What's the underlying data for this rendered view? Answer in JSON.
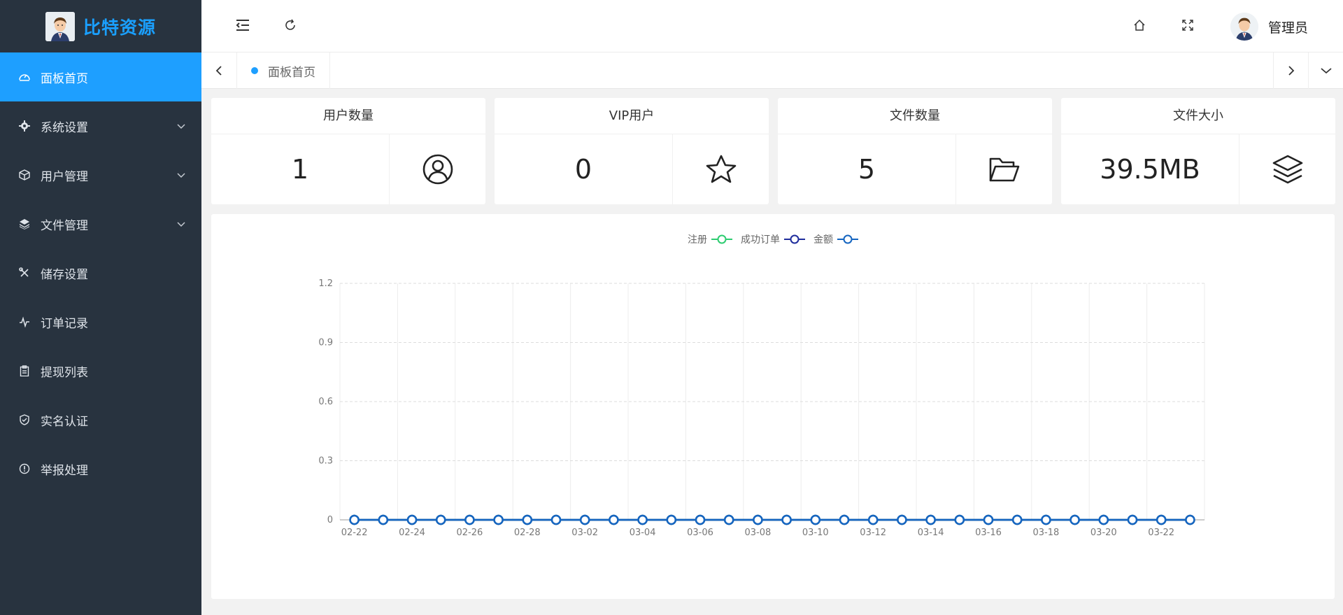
{
  "app": {
    "brand": "比特资源"
  },
  "sidebar": {
    "items": [
      {
        "label": "面板首页",
        "icon": "dashboard-icon",
        "active": true,
        "expandable": false
      },
      {
        "label": "系统设置",
        "icon": "gear-icon",
        "active": false,
        "expandable": true
      },
      {
        "label": "用户管理",
        "icon": "cube-icon",
        "active": false,
        "expandable": true
      },
      {
        "label": "文件管理",
        "icon": "layers-icon",
        "active": false,
        "expandable": true
      },
      {
        "label": "储存设置",
        "icon": "tools-icon",
        "active": false,
        "expandable": false
      },
      {
        "label": "订单记录",
        "icon": "pulse-icon",
        "active": false,
        "expandable": false
      },
      {
        "label": "提现列表",
        "icon": "clipboard-icon",
        "active": false,
        "expandable": false
      },
      {
        "label": "实名认证",
        "icon": "shield-icon",
        "active": false,
        "expandable": false
      },
      {
        "label": "举报处理",
        "icon": "info-icon",
        "active": false,
        "expandable": false
      }
    ]
  },
  "header": {
    "user_name": "管理员"
  },
  "tabs": [
    {
      "label": "面板首页"
    }
  ],
  "stats": [
    {
      "title": "用户数量",
      "value": "1",
      "icon": "user-circle-icon"
    },
    {
      "title": "VIP用户",
      "value": "0",
      "icon": "star-icon"
    },
    {
      "title": "文件数量",
      "value": "5",
      "icon": "folder-open-icon"
    },
    {
      "title": "文件大小",
      "value": "39.5MB",
      "icon": "layers-icon"
    }
  ],
  "colors": {
    "accent": "#1e9fff",
    "sidebar_bg": "#28333f",
    "brand": "#1aa0ff"
  },
  "chart_data": {
    "type": "line",
    "title": "",
    "xlabel": "",
    "ylabel": "",
    "x": [
      "02-22",
      "02-23",
      "02-24",
      "02-25",
      "02-26",
      "02-27",
      "02-28",
      "03-01",
      "03-02",
      "03-03",
      "03-04",
      "03-05",
      "03-06",
      "03-07",
      "03-08",
      "03-09",
      "03-10",
      "03-11",
      "03-12",
      "03-13",
      "03-14",
      "03-15",
      "03-16",
      "03-17",
      "03-18",
      "03-19",
      "03-20",
      "03-21",
      "03-22",
      "03-23"
    ],
    "x_tick_labels": [
      "02-22",
      "02-24",
      "02-26",
      "02-28",
      "03-02",
      "03-04",
      "03-06",
      "03-08",
      "03-10",
      "03-12",
      "03-14",
      "03-16",
      "03-18",
      "03-20",
      "03-22"
    ],
    "ylim": [
      0,
      1.2
    ],
    "y_ticks": [
      "0",
      "0.3",
      "0.6",
      "0.9",
      "1.2"
    ],
    "grid": true,
    "legend_position": "top-center",
    "series": [
      {
        "name": "注册",
        "color": "#2ecc71",
        "values": [
          0,
          0,
          0,
          0,
          0,
          0,
          0,
          0,
          0,
          0,
          0,
          0,
          0,
          0,
          0,
          0,
          0,
          0,
          0,
          0,
          0,
          0,
          0,
          0,
          0,
          0,
          0,
          0,
          0,
          0
        ]
      },
      {
        "name": "成功订单",
        "color": "#1f2d9c",
        "values": [
          0,
          0,
          0,
          0,
          0,
          0,
          0,
          0,
          0,
          0,
          0,
          0,
          0,
          0,
          0,
          0,
          0,
          0,
          0,
          0,
          0,
          0,
          0,
          0,
          0,
          0,
          0,
          0,
          0,
          0
        ]
      },
      {
        "name": "金额",
        "color": "#1565c0",
        "values": [
          0,
          0,
          0,
          0,
          0,
          0,
          0,
          0,
          0,
          0,
          0,
          0,
          0,
          0,
          0,
          0,
          0,
          0,
          0,
          0,
          0,
          0,
          0,
          0,
          0,
          0,
          0,
          0,
          0,
          0
        ]
      }
    ]
  }
}
